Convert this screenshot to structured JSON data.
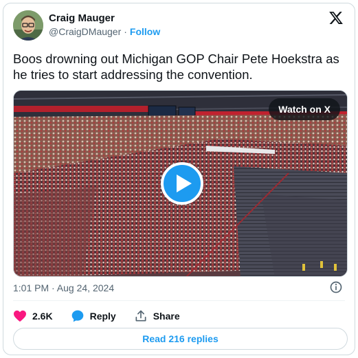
{
  "author": {
    "name": "Craig Mauger",
    "handle": "@CraigDMauger",
    "separator": "·",
    "follow_label": "Follow"
  },
  "tweet": {
    "text": "Boos drowning out Michigan GOP Chair Pete Hoekstra as he tries to start addressing the convention.",
    "timestamp": "1:01 PM · Aug 24, 2024"
  },
  "media": {
    "watch_label": "Watch on X"
  },
  "actions": {
    "likes": "2.6K",
    "reply_label": "Reply",
    "share_label": "Share"
  },
  "read_replies_label": "Read 216 replies",
  "colors": {
    "accent": "#1d9bf0",
    "like": "#f91880",
    "text_primary": "#0f1419",
    "text_secondary": "#536471",
    "border": "#cfd9de"
  },
  "icons": [
    "x-logo-icon",
    "play-icon",
    "info-icon",
    "heart-icon",
    "reply-bubble-icon",
    "share-icon"
  ]
}
